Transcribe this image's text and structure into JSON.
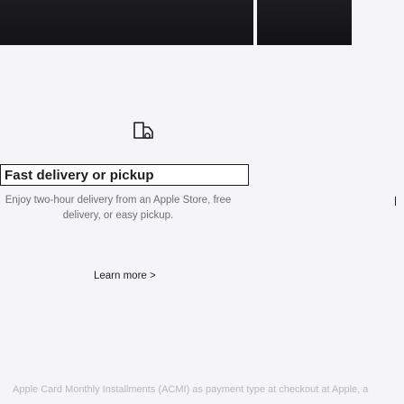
{
  "colors": {
    "background": "#f5f5f7",
    "text_primary": "#1d1d1f",
    "text_secondary": "#6e6e73",
    "text_faded": "#b8b8bd",
    "hero_dark": "#1c1c1e"
  },
  "card": {
    "icon": "delivery-box-icon",
    "headline": "Fast delivery or pickup",
    "description": "Enjoy two-hour delivery from an Apple Store, free delivery, or easy pickup.",
    "link_label": "Learn more >"
  },
  "footer": {
    "text": "Apple Card Monthly Installments (ACMI) as payment type at checkout at Apple, a"
  }
}
